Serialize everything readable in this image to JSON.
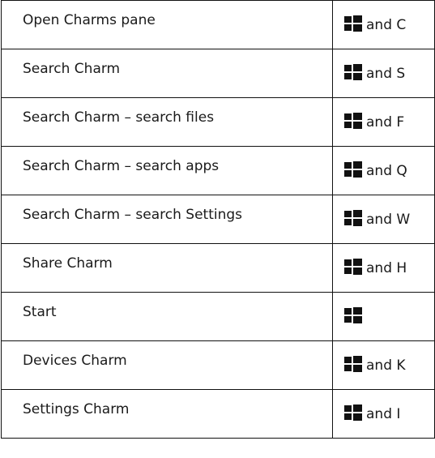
{
  "shortcuts": [
    {
      "action": "Open Charms pane",
      "key_suffix": "and C"
    },
    {
      "action": "Search Charm",
      "key_suffix": "and S"
    },
    {
      "action": "Search Charm – search files",
      "key_suffix": "and F"
    },
    {
      "action": "Search Charm – search apps",
      "key_suffix": "and Q"
    },
    {
      "action": "Search Charm – search Settings",
      "key_suffix": "and W"
    },
    {
      "action": "Share Charm",
      "key_suffix": "and H"
    },
    {
      "action": "Start",
      "key_suffix": ""
    },
    {
      "action": "Devices Charm",
      "key_suffix": "and K"
    },
    {
      "action": "Settings Charm",
      "key_suffix": "and I"
    }
  ],
  "icon": {
    "name": "windows-key-icon",
    "color": "#111111"
  }
}
